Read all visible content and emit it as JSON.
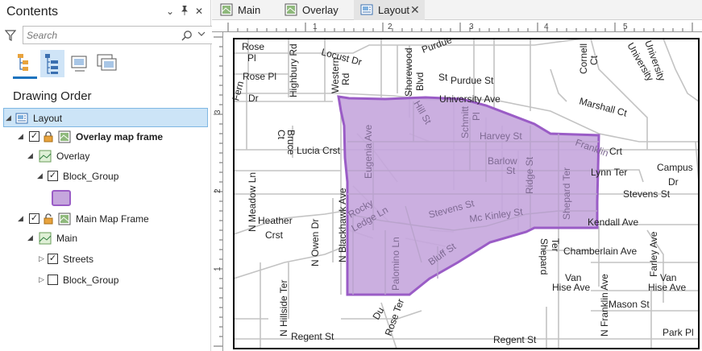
{
  "contents": {
    "title": "Contents",
    "controls": {
      "dropdown": "⌄",
      "pin": "📌",
      "close": "✕"
    },
    "search_placeholder": "Search",
    "drawing_order_label": "Drawing Order",
    "tree": {
      "layout": "Layout",
      "overlay_map_frame": "Overlay map frame",
      "overlay": "Overlay",
      "block_group": "Block_Group",
      "main_map_frame": "Main Map Frame",
      "main": "Main",
      "streets": "Streets",
      "block_group_2": "Block_Group"
    }
  },
  "tabs": [
    {
      "label": "Main",
      "icon": "map-icon"
    },
    {
      "label": "Overlay",
      "icon": "map-icon"
    },
    {
      "label": "Layout",
      "icon": "layout-icon",
      "active": true
    }
  ],
  "ruler": {
    "top": [
      "1",
      "2",
      "3",
      "4",
      "5"
    ],
    "left": [
      "3",
      "2",
      "1"
    ]
  },
  "colors": {
    "accent": "#1e73be",
    "selection": "#cce4f7",
    "polygon_fill": "#c5a6dd",
    "polygon_stroke": "#9a5cc6",
    "street": "#bdbdbd"
  },
  "streets": {
    "rose_pl_v": [
      "Rose",
      "Pl"
    ],
    "rose_pl": "Rose Pl",
    "fern_dr": [
      "Fern",
      "Dr"
    ],
    "highbury_rd": "Highbury Rd",
    "locust_dr": "Locust Dr",
    "western_rd": [
      "Western",
      "Rd"
    ],
    "shorewood_blvd": [
      "Shorewood",
      "Blvd"
    ],
    "purdue_st_v": [
      "Purdue",
      "St"
    ],
    "purdue_st": "Purdue St",
    "cornell_ct": [
      "Cornell",
      "Ct"
    ],
    "university_dr": [
      "University",
      "Dr"
    ],
    "university_bay_dr": [
      "University",
      "Bay Dr"
    ],
    "university_ave": "University Ave",
    "marshall_ct": "Marshall Ct",
    "hill_st": "Hill St",
    "schmitt_pl": [
      "Schmitt",
      "Pl"
    ],
    "harvey_st": "Harvey St",
    "franklin_crt": [
      "Franklin",
      "Crt"
    ],
    "bruce_ct": [
      "Bruce",
      "Ct"
    ],
    "lucia_crst": "Lucia Crst",
    "eugenia_ave": "Eugenia Ave",
    "barlow_st": [
      "Barlow",
      "St"
    ],
    "ridge_st": "Ridge St",
    "shepard_ter": "Shepard Ter",
    "lynn_ter": "Lynn Ter",
    "campus_dr": [
      "Campus",
      "Dr"
    ],
    "n_meadow_ln": "N Meadow Ln",
    "n_blackhawk_ave": "N Blackhawk Ave",
    "stevens_st": "Stevens St",
    "stevens_st_2": "Stevens St",
    "heather_crst": [
      "Heather",
      "Crst"
    ],
    "rocky_ledge_ln": [
      "Rocky",
      "Ledge Ln"
    ],
    "mckinley_st": "Mc Kinley St",
    "kendall_ave": "Kendall Ave",
    "n_owen_dr": "N Owen Dr",
    "palomino_ln": "Palomino Ln",
    "bluff_st": "Bluff St",
    "shepard_ter_2": [
      "Shepard",
      "Ter"
    ],
    "chamberlain_ave": "Chamberlain Ave",
    "farley_ave": "Farley Ave",
    "n_hillside_ter": "N Hillside Ter",
    "van_hise_ave": [
      "Van",
      "Hise Ave"
    ],
    "van_hise_ave_2": [
      "Van",
      "Hise Ave"
    ],
    "n_franklin_ave": "N Franklin Ave",
    "mason_st": "Mason St",
    "du_rose_ter": [
      "Du",
      "Rose Ter"
    ],
    "regent_st": "Regent St",
    "regent_st_2": "Regent St",
    "park_pl": "Park Pl"
  }
}
